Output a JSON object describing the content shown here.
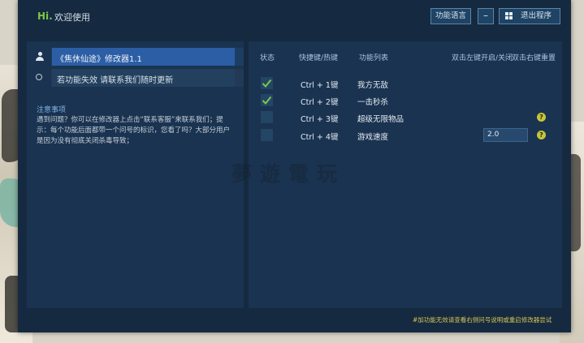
{
  "titlebar": {
    "hi": "Hi.",
    "welcome": "欢迎使用",
    "lang_button": "功能语言",
    "minimize_label": "–",
    "exit_label": "退出程序"
  },
  "left": {
    "game_title": "《焦休仙途》修改器1.1",
    "feedback": "若功能失效 请联系我们随时更新",
    "notice_title": "注意事项",
    "notice_text": "遇到问题？你可以在修改器上点击“联系客服”来联系我们；提示：每个功能后面都带一个问号的标识，您看了吗？大部分用户是因为没有彻底关闭杀毒导致；"
  },
  "right": {
    "headers": {
      "status": "状态",
      "hotkey": "快捷键/热键",
      "func": "功能列表",
      "dblclick": "双击左键开启/关闭",
      "rclick": "双击右键重置"
    },
    "features": [
      {
        "hotkey": "Ctrl + 1键",
        "name": "我方无敌",
        "checked": true
      },
      {
        "hotkey": "Ctrl + 2键",
        "name": "一击秒杀",
        "checked": true
      },
      {
        "hotkey": "Ctrl + 3键",
        "name": "超级无限物品",
        "checked": false
      },
      {
        "hotkey": "Ctrl + 4键",
        "name": "游戏速度",
        "checked": false,
        "value": "2.0"
      }
    ],
    "help_icon": "?"
  },
  "watermark": "夢遊電玩",
  "footer_note": "#加功能无效请查看右侧问号说明或重启修改器尝试",
  "icons": [
    "user-icon",
    "circle-icon",
    "checkmark-icon",
    "help-icon",
    "windows-icon",
    "cursor-icon"
  ],
  "colors": {
    "accent_green": "#7dc846",
    "selection_blue": "#2c5ea6",
    "panel": "#1a3350",
    "help_yellow": "#c6c53a"
  }
}
